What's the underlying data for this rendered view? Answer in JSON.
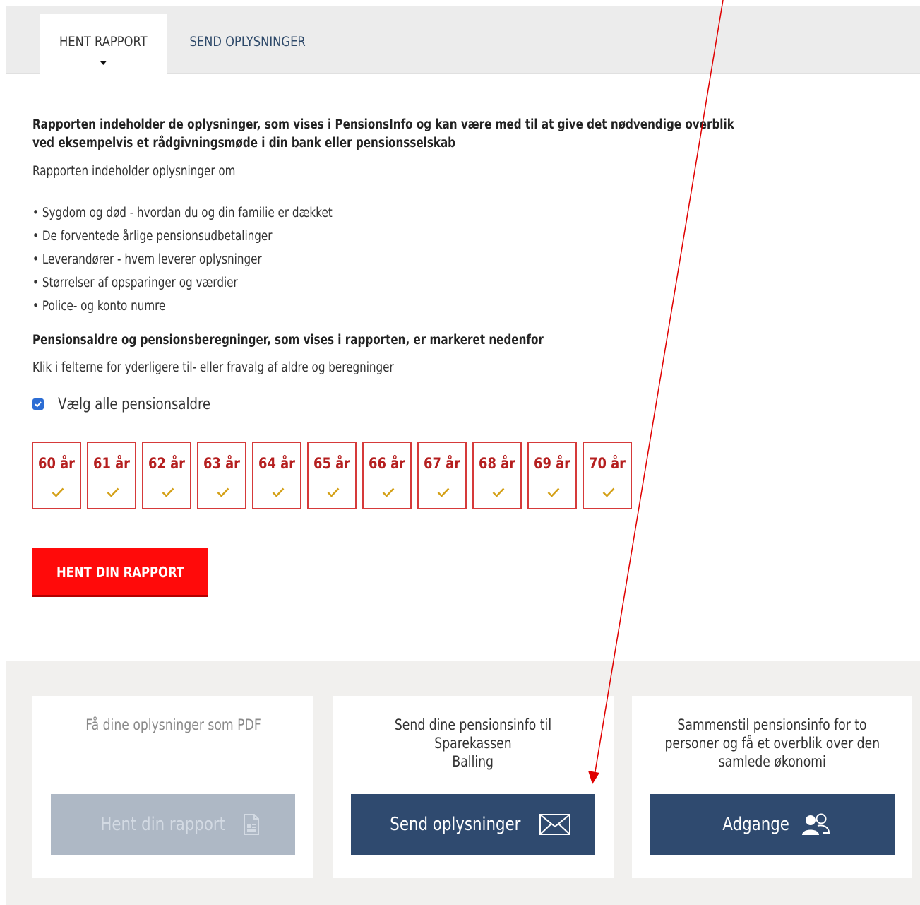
{
  "tabs": [
    {
      "label": "HENT RAPPORT",
      "active": true
    },
    {
      "label": "SEND OPLYSNINGER",
      "active": false
    }
  ],
  "report": {
    "intro_bold": [
      "Rapporten indeholder de oplysninger, som vises i PensionsInfo og kan være med til at give det nødvendige overblik",
      "ved eksempelvis et rådgivningsmøde i din bank eller pensionsselskab"
    ],
    "intro_sub": "Rapporten indeholder oplysninger om",
    "bullets": [
      "Sygdom og død - hvordan du og din familie er dækket",
      "De forventede årlige pensionsudbetalinger",
      "Leverandører - hvem leverer oplysninger",
      "Størrelser af opsparinger og værdier",
      "Police- og konto numre"
    ],
    "ages_heading": "Pensionsaldre og pensionsberegninger, som vises i rapporten, er markeret nedenfor",
    "ages_hint": "Klik i felterne for yderligere til- eller fravalg af aldre og beregninger",
    "select_all_label": "Vælg alle pensionsaldre",
    "select_all_checked": true,
    "ages": [
      {
        "label": "60 år",
        "checked": true
      },
      {
        "label": "61 år",
        "checked": true
      },
      {
        "label": "62 år",
        "checked": true
      },
      {
        "label": "63 år",
        "checked": true
      },
      {
        "label": "64 år",
        "checked": true
      },
      {
        "label": "65 år",
        "checked": true
      },
      {
        "label": "66 år",
        "checked": true
      },
      {
        "label": "67 år",
        "checked": true
      },
      {
        "label": "68 år",
        "checked": true
      },
      {
        "label": "69 år",
        "checked": true
      },
      {
        "label": "70 år",
        "checked": true
      }
    ],
    "button_label": "HENT DIN RAPPORT"
  },
  "cards": [
    {
      "text": [
        "Få dine oplysninger som PDF"
      ],
      "button_label": "Hent din rapport",
      "icon": "document-icon",
      "disabled": true
    },
    {
      "text": [
        "Send dine pensionsinfo til Sparekassen",
        "Balling"
      ],
      "button_label": "Send oplysninger",
      "icon": "envelope-icon",
      "disabled": false
    },
    {
      "text": [
        "Sammenstil pensionsinfo for to",
        "personer og få et overblik over den",
        "samlede økonomi"
      ],
      "button_label": "Adgange",
      "icon": "people-icon",
      "disabled": false
    }
  ],
  "colors": {
    "accent_red": "#ff0a0a",
    "age_border": "#d63a3a",
    "age_text": "#b51f1f",
    "check_gold": "#d4a017",
    "navy": "#2f4a6f",
    "disabled": "#aeb8c5",
    "annotation_arrow": "#e00000"
  }
}
